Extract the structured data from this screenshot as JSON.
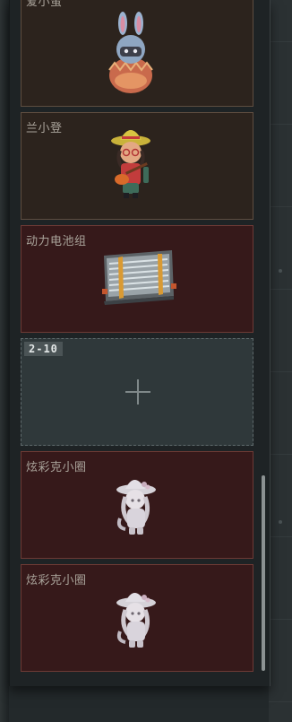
{
  "slots": [
    {
      "name": "爱小萤",
      "item_icon": "bunny-egg-figure-icon",
      "rarity": "brown"
    },
    {
      "name": "兰小登",
      "item_icon": "sombrero-guitar-figure-icon",
      "rarity": "brown"
    },
    {
      "name": "动力电池组",
      "item_icon": "battery-pack-icon",
      "rarity": "red"
    },
    {
      "level_range": "2-10",
      "action_icon": "plus-icon",
      "rarity": "empty"
    },
    {
      "name": "炫彩克小圈",
      "item_icon": "sunhat-doll-figure-icon",
      "rarity": "red"
    },
    {
      "name": "炫彩克小圈",
      "item_icon": "sunhat-doll-figure-icon",
      "rarity": "red"
    }
  ],
  "colors": {
    "brown_slot": "#2c231d",
    "red_slot": "#36191a",
    "empty_slot": "#2f383a"
  }
}
